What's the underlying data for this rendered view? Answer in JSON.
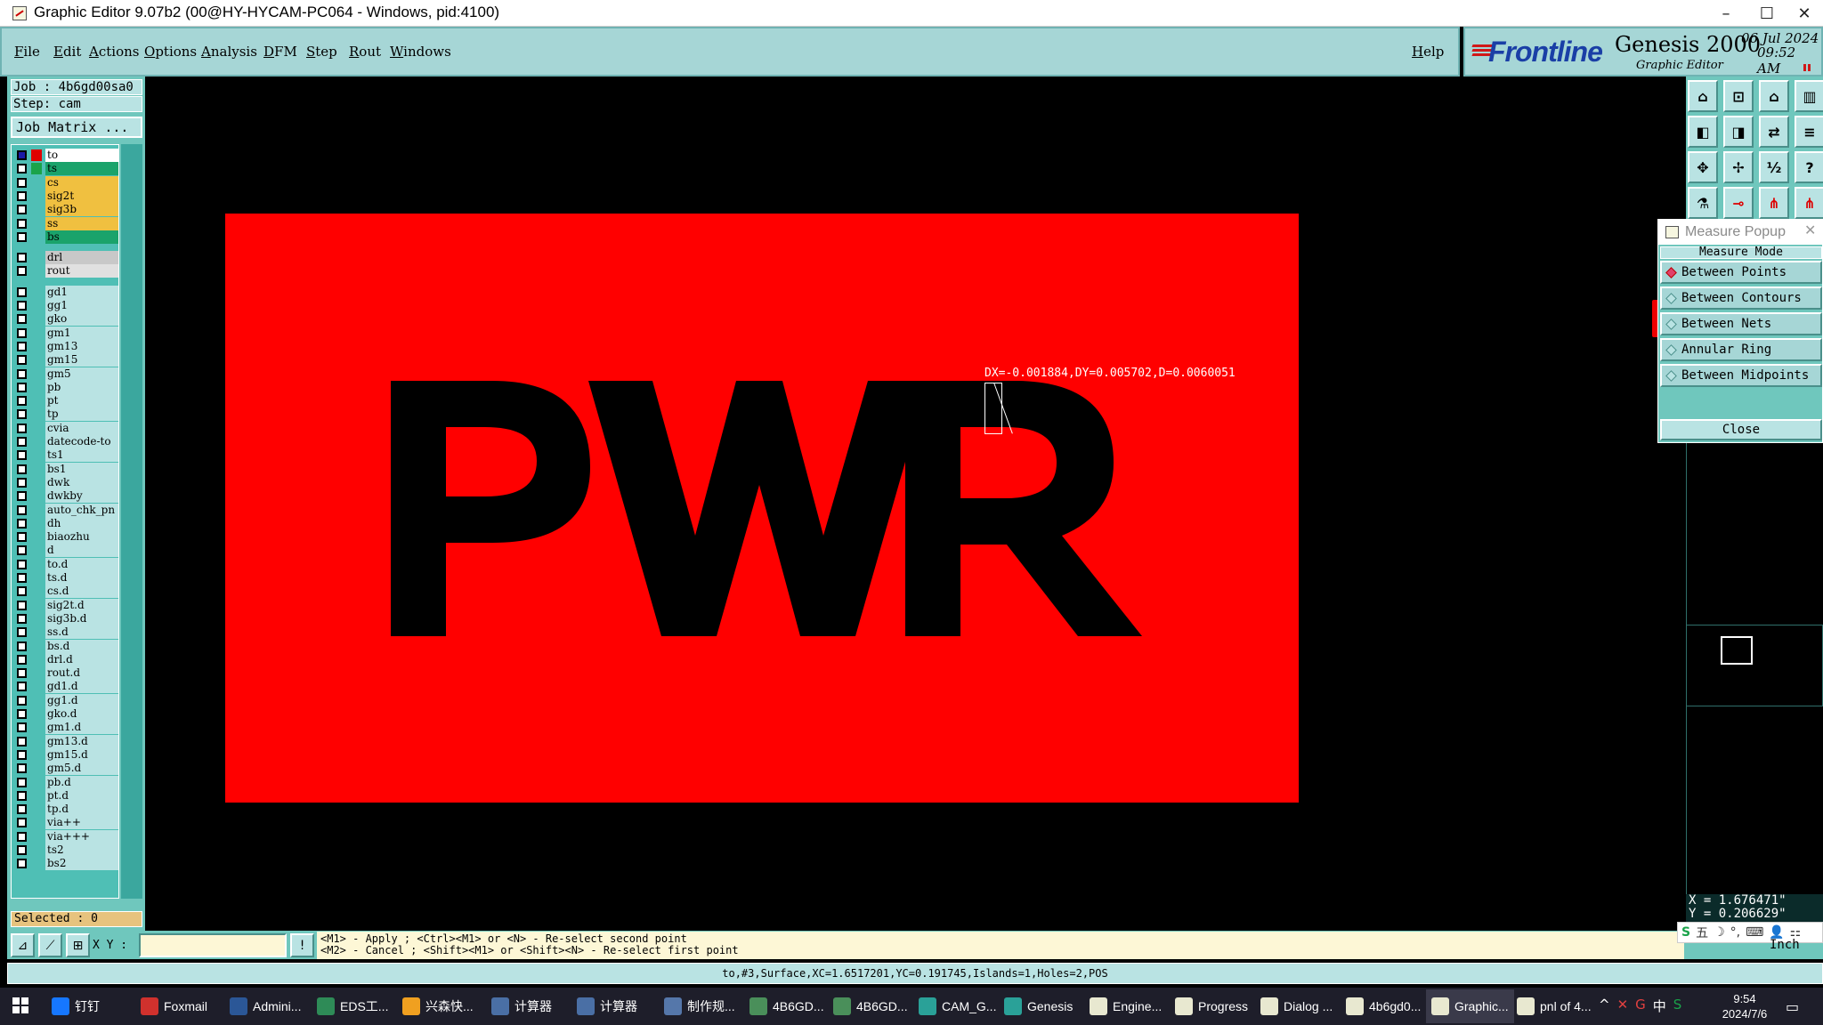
{
  "window": {
    "title": "Graphic Editor 9.07b2 (00@HY-HYCAM-PC064 - Windows, pid:4100)",
    "controls": [
      "–",
      "☐",
      "✕"
    ]
  },
  "menu": {
    "items": [
      "File",
      "Edit",
      "Actions",
      "Options",
      "Analysis",
      "DFM",
      "Step",
      "Rout",
      "Windows"
    ],
    "help": "Help"
  },
  "brand": {
    "logo": "Frontline",
    "product": "Genesis 2000",
    "subtitle": "Graphic Editor",
    "date": "06 Jul 2024",
    "time": "09:52 AM"
  },
  "job": {
    "job_label": "Job : 4b6gd00sa0",
    "step_label": "Step: cam",
    "matrix_button": "Job Matrix ..."
  },
  "layers": [
    {
      "name": "to",
      "color": "#ffffff",
      "swatch": "#e00000",
      "group": 0
    },
    {
      "name": "ts",
      "color": "#1aa36b",
      "swatch": "#1aa34a",
      "group": 0
    },
    {
      "name": "cs",
      "color": "#f0c040",
      "swatch": "",
      "group": 0
    },
    {
      "name": "sig2t",
      "color": "#f0c040",
      "swatch": "",
      "group": 0
    },
    {
      "name": "sig3b",
      "color": "#f0c040",
      "swatch": "",
      "group": 0
    },
    {
      "name": "ss",
      "color": "#f0c040",
      "swatch": "",
      "group": 0
    },
    {
      "name": "bs",
      "color": "#1aa36b",
      "swatch": "",
      "group": 0
    },
    {
      "name": "drl",
      "color": "#c8c8c8",
      "swatch": "",
      "group": 1
    },
    {
      "name": "rout",
      "color": "#e0e0e0",
      "swatch": "",
      "group": 1
    },
    {
      "name": "gd1",
      "color": "#b9e3e3",
      "swatch": "",
      "group": 2
    },
    {
      "name": "gg1",
      "color": "#b9e3e3",
      "swatch": "",
      "group": 2
    },
    {
      "name": "gko",
      "color": "#b9e3e3",
      "swatch": "",
      "group": 2
    },
    {
      "name": "gm1",
      "color": "#b9e3e3",
      "swatch": "",
      "group": 2
    },
    {
      "name": "gm13",
      "color": "#b9e3e3",
      "swatch": "",
      "group": 2
    },
    {
      "name": "gm15",
      "color": "#b9e3e3",
      "swatch": "",
      "group": 2
    },
    {
      "name": "gm5",
      "color": "#b9e3e3",
      "swatch": "",
      "group": 2
    },
    {
      "name": "pb",
      "color": "#b9e3e3",
      "swatch": "",
      "group": 2
    },
    {
      "name": "pt",
      "color": "#b9e3e3",
      "swatch": "",
      "group": 2
    },
    {
      "name": "tp",
      "color": "#b9e3e3",
      "swatch": "",
      "group": 2
    },
    {
      "name": "cvia",
      "color": "#b9e3e3",
      "swatch": "",
      "group": 2
    },
    {
      "name": "datecode-to",
      "color": "#b9e3e3",
      "swatch": "",
      "group": 2
    },
    {
      "name": "ts1",
      "color": "#b9e3e3",
      "swatch": "",
      "group": 2
    },
    {
      "name": "bs1",
      "color": "#b9e3e3",
      "swatch": "",
      "group": 2
    },
    {
      "name": "dwk",
      "color": "#b9e3e3",
      "swatch": "",
      "group": 2
    },
    {
      "name": "dwkby",
      "color": "#b9e3e3",
      "swatch": "",
      "group": 2
    },
    {
      "name": "auto_chk_pn",
      "color": "#b9e3e3",
      "swatch": "",
      "group": 2
    },
    {
      "name": "dh",
      "color": "#b9e3e3",
      "swatch": "",
      "group": 2
    },
    {
      "name": "biaozhu",
      "color": "#b9e3e3",
      "swatch": "",
      "group": 2
    },
    {
      "name": "d",
      "color": "#b9e3e3",
      "swatch": "",
      "group": 2
    },
    {
      "name": "to.d",
      "color": "#b9e3e3",
      "swatch": "",
      "group": 2
    },
    {
      "name": "ts.d",
      "color": "#b9e3e3",
      "swatch": "",
      "group": 2
    },
    {
      "name": "cs.d",
      "color": "#b9e3e3",
      "swatch": "",
      "group": 2
    },
    {
      "name": "sig2t.d",
      "color": "#b9e3e3",
      "swatch": "",
      "group": 2
    },
    {
      "name": "sig3b.d",
      "color": "#b9e3e3",
      "swatch": "",
      "group": 2
    },
    {
      "name": "ss.d",
      "color": "#b9e3e3",
      "swatch": "",
      "group": 2
    },
    {
      "name": "bs.d",
      "color": "#b9e3e3",
      "swatch": "",
      "group": 2
    },
    {
      "name": "drl.d",
      "color": "#b9e3e3",
      "swatch": "",
      "group": 2
    },
    {
      "name": "rout.d",
      "color": "#b9e3e3",
      "swatch": "",
      "group": 2
    },
    {
      "name": "gd1.d",
      "color": "#b9e3e3",
      "swatch": "",
      "group": 2
    },
    {
      "name": "gg1.d",
      "color": "#b9e3e3",
      "swatch": "",
      "group": 2
    },
    {
      "name": "gko.d",
      "color": "#b9e3e3",
      "swatch": "",
      "group": 2
    },
    {
      "name": "gm1.d",
      "color": "#b9e3e3",
      "swatch": "",
      "group": 2
    },
    {
      "name": "gm13.d",
      "color": "#b9e3e3",
      "swatch": "",
      "group": 2
    },
    {
      "name": "gm15.d",
      "color": "#b9e3e3",
      "swatch": "",
      "group": 2
    },
    {
      "name": "gm5.d",
      "color": "#b9e3e3",
      "swatch": "",
      "group": 2
    },
    {
      "name": "pb.d",
      "color": "#b9e3e3",
      "swatch": "",
      "group": 2
    },
    {
      "name": "pt.d",
      "color": "#b9e3e3",
      "swatch": "",
      "group": 2
    },
    {
      "name": "tp.d",
      "color": "#b9e3e3",
      "swatch": "",
      "group": 2
    },
    {
      "name": "via++",
      "color": "#b9e3e3",
      "swatch": "",
      "group": 2
    },
    {
      "name": "via+++",
      "color": "#b9e3e3",
      "swatch": "",
      "group": 2
    },
    {
      "name": "ts2",
      "color": "#b9e3e3",
      "swatch": "",
      "group": 2
    },
    {
      "name": "bs2",
      "color": "#b9e3e3",
      "swatch": "",
      "group": 2
    }
  ],
  "selected": "Selected : 0",
  "canvas": {
    "board_color": "#ff0000",
    "graphic_text": "PWR",
    "measure_readout": "DX=-0.001884,DY=0.005702,D=0.0060051"
  },
  "measure_popup": {
    "title": "Measure Popup",
    "mode_label": "Measure Mode",
    "options": [
      "Between Points",
      "Between Contours",
      "Between Nets",
      "Annular Ring",
      "Between Midpoints"
    ],
    "selected": "Between Points",
    "close_label": "Close"
  },
  "coords": {
    "x": "X = 1.676471\"",
    "y": "Y = 0.206629\""
  },
  "command": {
    "xy_label": "X Y :",
    "xy_value": "",
    "hint1": "<M1> - Apply  ; <Ctrl><M1> or <N> - Re-select second point",
    "hint2": "<M2> - Cancel ; <Shift><M1> or <Shift><N> - Re-select first point",
    "unit": "Inch"
  },
  "status": "to,#3,Surface,XC=1.6517201,YC=0.191745,Islands=1,Holes=2,POS",
  "ime": {
    "items": [
      "S",
      "五",
      "☽",
      "°,",
      "⌨",
      "👤",
      "⚏"
    ]
  },
  "taskbar": {
    "items": [
      {
        "label": "钉钉",
        "color": "#1677ff"
      },
      {
        "label": "Foxmail",
        "color": "#d0312d"
      },
      {
        "label": "Admini...",
        "color": "#2b5797"
      },
      {
        "label": "EDS工...",
        "color": "#2e8b57"
      },
      {
        "label": "兴森快...",
        "color": "#f0a020"
      },
      {
        "label": "计算器",
        "color": "#4a6fa5"
      },
      {
        "label": "计算器",
        "color": "#4a6fa5"
      },
      {
        "label": "制作规...",
        "color": "#5577aa"
      },
      {
        "label": "4B6GD...",
        "color": "#4a8f5a"
      },
      {
        "label": "4B6GD...",
        "color": "#4a8f5a"
      },
      {
        "label": "CAM_G...",
        "color": "#2aa198"
      },
      {
        "label": "Genesis",
        "color": "#2aa198"
      },
      {
        "label": "Engine...",
        "color": "#e8e8d0"
      },
      {
        "label": "Progress",
        "color": "#e8e8d0"
      },
      {
        "label": "Dialog ...",
        "color": "#e8e8d0"
      },
      {
        "label": "4b6gd0...",
        "color": "#e8e8d0"
      },
      {
        "label": "Graphic...",
        "color": "#e8e8d0"
      },
      {
        "label": "pnl of 4...",
        "color": "#e8e8d0"
      }
    ],
    "tray_icons": [
      "^",
      "✕",
      "G",
      "中",
      "S"
    ],
    "clock_time": "9:54",
    "clock_date": "2024/7/6"
  }
}
